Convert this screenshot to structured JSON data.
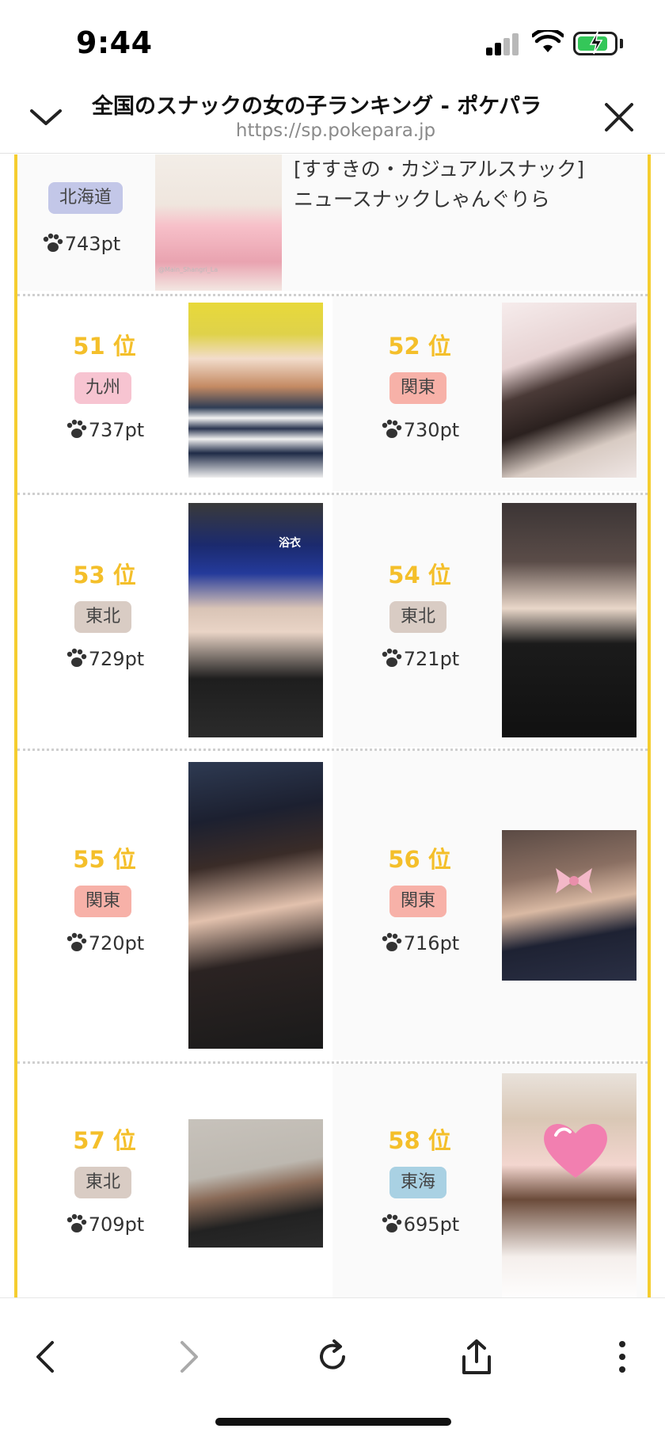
{
  "status_bar": {
    "time": "9:44",
    "icons": [
      "signal-icon",
      "wifi-icon",
      "battery-charging-icon"
    ]
  },
  "browser": {
    "title": "全国のスナックの女の子ランキング - ポケパラ",
    "url": "https://sp.pokepara.jp",
    "icons": [
      "chevron-down-icon",
      "close-icon"
    ]
  },
  "colors": {
    "frame": "#f5cd2f",
    "rank_text": "#f4bf2a",
    "region_kyushu": "#f7c4d1",
    "region_kanto": "#f7b1a8",
    "region_tohoku": "#d9ccc4",
    "region_tokai": "#a9d1e3",
    "region_hokkaido": "#c3c7e8"
  },
  "top_entry": {
    "region": "北海道",
    "points": "743pt",
    "shop": "[すすきの・カジュアルスナック]",
    "shop_name": "ニュースナックしゃんぐりら",
    "photo_credit": "@Main_Shangri_La"
  },
  "rankings": [
    {
      "rank": "51 位",
      "region": "九州",
      "points": "737pt"
    },
    {
      "rank": "52 位",
      "region": "関東",
      "points": "730pt"
    },
    {
      "rank": "53 位",
      "region": "東北",
      "points": "729pt",
      "photo_caption": "浴衣"
    },
    {
      "rank": "54 位",
      "region": "東北",
      "points": "721pt"
    },
    {
      "rank": "55 位",
      "region": "関東",
      "points": "720pt"
    },
    {
      "rank": "56 位",
      "region": "関東",
      "points": "716pt"
    },
    {
      "rank": "57 位",
      "region": "東北",
      "points": "709pt"
    },
    {
      "rank": "58 位",
      "region": "東海",
      "points": "695pt"
    }
  ],
  "toolbar": {
    "icons": [
      "back-icon",
      "forward-icon",
      "reload-icon",
      "share-icon",
      "more-icon"
    ]
  }
}
